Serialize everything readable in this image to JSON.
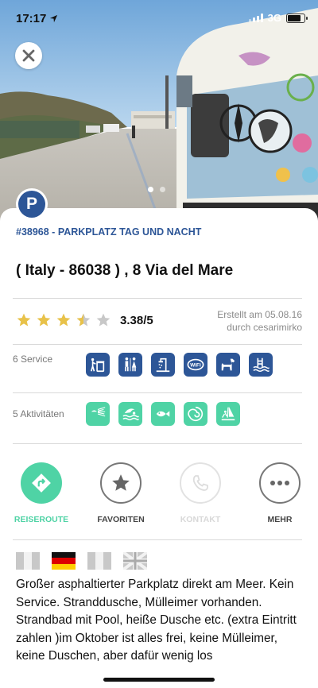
{
  "status_bar": {
    "time": "17:17",
    "network": "3G"
  },
  "hero": {
    "photo_alt": "",
    "pager": {
      "count": 2,
      "active_index": 0
    }
  },
  "place": {
    "type_letter": "P",
    "id_line": "#38968 - PARKPLATZ TAG UND NACHT",
    "title": "( Italy - 86038 ) , 8 Via del Mare",
    "rating": {
      "value": 3.38,
      "display": "3.38/5",
      "stars_total": 5
    },
    "created_line1": "Erstellt am 05.08.16",
    "created_line2": "durch cesarimirko"
  },
  "services": {
    "label": "6 Service",
    "icons": [
      "trash-icon",
      "toilet-icon",
      "shower-icon",
      "wifi-icon",
      "dog-icon",
      "swimming-pool-icon"
    ]
  },
  "activities": {
    "label": "5 Aktivitäten",
    "icons": [
      "beach-shower-icon",
      "swimming-icon",
      "fish-icon",
      "shell-icon",
      "windsurf-icon"
    ]
  },
  "actions": [
    {
      "label": "REISEROUTE",
      "icon": "directions-icon",
      "state": "active"
    },
    {
      "label": "FAVORITEN",
      "icon": "star-icon",
      "state": "normal"
    },
    {
      "label": "KONTAKT",
      "icon": "phone-icon",
      "state": "disabled"
    },
    {
      "label": "MEHR",
      "icon": "more-icon",
      "state": "normal"
    }
  ],
  "languages": [
    "flag-italy-icon",
    "flag-germany-icon",
    "flag-france-icon",
    "flag-uk-icon"
  ],
  "description": "Großer asphaltierter Parkplatz direkt am Meer. Kein Service. Stranddusche, Mülleimer vorhanden. Strandbad mit Pool, heiße Dusche etc. (extra Eintritt zahlen )im Oktober ist alles frei, keine Mülleimer, keine Duschen, aber dafür wenig los",
  "colors": {
    "brand_blue": "#2d5697",
    "activity_green": "#4fd3a5",
    "star_gold": "#e8c24a",
    "star_grey": "#c8c8c8"
  }
}
